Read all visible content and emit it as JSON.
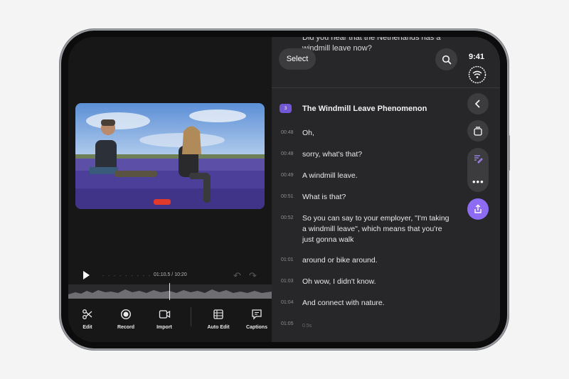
{
  "editor": {
    "timecode": "01:10.5 / 10:20",
    "toolbar": [
      {
        "label": "Edit",
        "icon": "scissors-icon"
      },
      {
        "label": "Record",
        "icon": "record-icon"
      },
      {
        "label": "Import",
        "icon": "import-icon"
      },
      {
        "label": "Auto Edit",
        "icon": "auto-edit-icon"
      },
      {
        "label": "Captions",
        "icon": "captions-icon"
      }
    ]
  },
  "transcript": {
    "partial_text": "Did you hear that the Netherlands has a windmill leave now?",
    "select_label": "Select",
    "chapter_number": "3",
    "chapter_title": "The Windmill Leave Phenomenon",
    "rows": [
      {
        "ts": "00:48",
        "text": "Oh,"
      },
      {
        "ts": "00:48",
        "text": "sorry, what's that?"
      },
      {
        "ts": "00:49",
        "text": "A windmill leave."
      },
      {
        "ts": "00:51",
        "text": "What is that?"
      },
      {
        "ts": "00:52",
        "text": "So you can say to your employer, \"I'm taking a windmill leave\", which means that you're just gonna walk"
      },
      {
        "ts": "01:01",
        "text": "around or bike around."
      },
      {
        "ts": "01:03",
        "text": "Oh wow, I didn't know."
      },
      {
        "ts": "01:04",
        "text": "And connect with nature."
      },
      {
        "ts": "01:05",
        "text": "0.5s"
      }
    ]
  },
  "status": {
    "time": "9:41"
  },
  "colors": {
    "accent": "#8d6cf3",
    "chapter_badge": "#7457d6"
  }
}
